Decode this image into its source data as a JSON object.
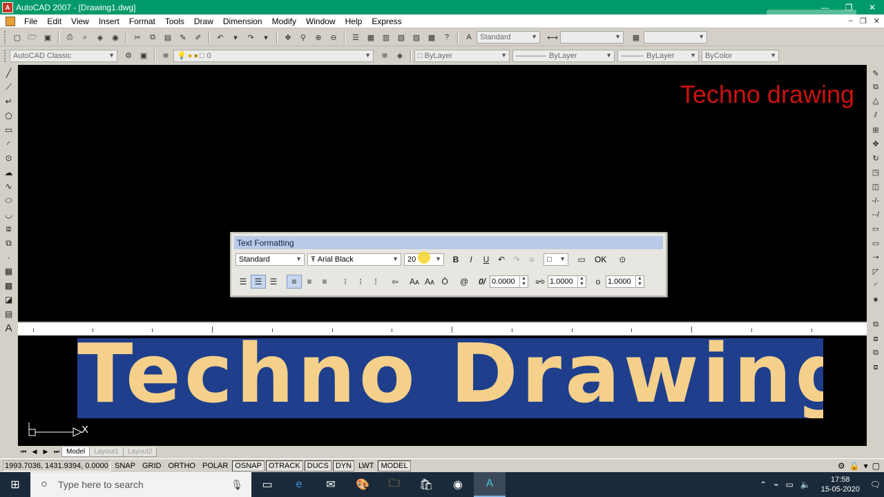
{
  "window": {
    "title": "AutoCAD 2007 - [Drawing1.dwg]",
    "app_icon": "A",
    "minimize": "—",
    "restore": "❐",
    "close": "✕"
  },
  "menubar": {
    "items": [
      "File",
      "Edit",
      "View",
      "Insert",
      "Format",
      "Tools",
      "Draw",
      "Dimension",
      "Modify",
      "Window",
      "Help",
      "Express"
    ],
    "mdi": {
      "minimize": "–",
      "restore": "❐",
      "close": "✕"
    }
  },
  "toolbar1": {
    "text_style": "Standard",
    "dim_style": "",
    "table_style": ""
  },
  "toolbar2": {
    "workspace": "AutoCAD Classic",
    "layer": "0",
    "color": "ByLayer",
    "linetype": "ByLayer",
    "lineweight": "ByLayer",
    "plotstyle": "ByColor"
  },
  "canvas": {
    "watermark": "Techno drawing",
    "mtext": "Techno Drawing",
    "ucs_axis_label": "X"
  },
  "text_formatting": {
    "title": "Text Formatting",
    "style": "Standard",
    "font": "Arial Black",
    "font_prefix": "Ŧ",
    "height": "20",
    "bold": "B",
    "italic": "I",
    "underline": "U",
    "ok": "OK",
    "insert_field": "@",
    "oblique_angle": "0.0000",
    "tracking": "1.0000",
    "width_factor": "1.0000",
    "oblique_label": "0/",
    "tracking_label": "a•b",
    "width_label": "o"
  },
  "layout_tabs": {
    "tabs": [
      "Model",
      "Layout1",
      "Layout2"
    ],
    "active": "Model"
  },
  "status": {
    "coords": "1993.7036, 1431.9394, 0.0000",
    "buttons": [
      {
        "label": "SNAP",
        "on": false
      },
      {
        "label": "GRID",
        "on": false
      },
      {
        "label": "ORTHO",
        "on": false
      },
      {
        "label": "POLAR",
        "on": false
      },
      {
        "label": "OSNAP",
        "on": true
      },
      {
        "label": "OTRACK",
        "on": true
      },
      {
        "label": "DUCS",
        "on": true
      },
      {
        "label": "DYN",
        "on": true
      },
      {
        "label": "LWT",
        "on": false
      },
      {
        "label": "MODEL",
        "on": true
      }
    ]
  },
  "taskbar": {
    "search_placeholder": "Type here to search",
    "time": "17:58",
    "date": "15-05-2020"
  },
  "colors": {
    "titlebar": "#009a6a",
    "canvas": "#000000",
    "watermark": "#cc1111",
    "mtext_fill": "#f5d08a",
    "mtext_bg": "#1f3f8c"
  }
}
